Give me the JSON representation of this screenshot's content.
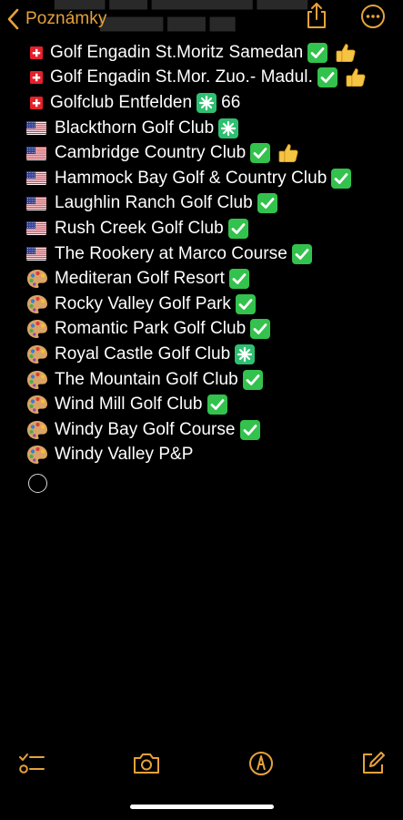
{
  "header": {
    "back_label": "Poznámky",
    "back_icon": "chevron-left-icon",
    "share_icon": "share-icon",
    "more_icon": "ellipsis-circle-icon",
    "accent": "#e6a23c"
  },
  "items": [
    {
      "flag": "swiss-flag-icon",
      "text": "Golf Engadin St.Moritz Samedan",
      "badges": [
        "check-mark-button-icon",
        "thumbs-up-icon"
      ],
      "suffix": ""
    },
    {
      "flag": "swiss-flag-icon",
      "text": "Golf Engadin St.Mor. Zuo.- Madul.",
      "badges": [
        "check-mark-button-icon",
        "thumbs-up-icon"
      ],
      "suffix": ""
    },
    {
      "flag": "swiss-flag-icon",
      "text": "Golfclub Entfelden",
      "badges": [
        "eight-spoked-asterisk-icon"
      ],
      "suffix": "66"
    },
    {
      "flag": "us-flag-icon",
      "text": "Blackthorn Golf Club",
      "badges": [
        "eight-spoked-asterisk-icon"
      ],
      "suffix": ""
    },
    {
      "flag": "us-flag-icon",
      "text": "Cambridge Country Club",
      "badges": [
        "check-mark-button-icon",
        "thumbs-up-icon"
      ],
      "suffix": ""
    },
    {
      "flag": "us-flag-icon",
      "text": "Hammock Bay Golf & Country Club",
      "badges": [
        "check-mark-button-icon"
      ],
      "suffix": ""
    },
    {
      "flag": "us-flag-icon",
      "text": "Laughlin Ranch Golf Club",
      "badges": [
        "check-mark-button-icon"
      ],
      "suffix": ""
    },
    {
      "flag": "us-flag-icon",
      "text": "Rush Creek Golf Club",
      "badges": [
        "check-mark-button-icon"
      ],
      "suffix": ""
    },
    {
      "flag": "us-flag-icon",
      "text": "The Rookery at Marco Course",
      "badges": [
        "check-mark-button-icon"
      ],
      "suffix": ""
    },
    {
      "flag": "artist-palette-icon",
      "text": "Mediteran Golf Resort",
      "badges": [
        "check-mark-button-icon"
      ],
      "suffix": ""
    },
    {
      "flag": "artist-palette-icon",
      "text": "Rocky Valley Golf Park",
      "badges": [
        "check-mark-button-icon"
      ],
      "suffix": ""
    },
    {
      "flag": "artist-palette-icon",
      "text": "Romantic Park Golf Club",
      "badges": [
        "check-mark-button-icon"
      ],
      "suffix": ""
    },
    {
      "flag": "artist-palette-icon",
      "text": "Royal Castle Golf Club",
      "badges": [
        "eight-spoked-asterisk-icon"
      ],
      "suffix": ""
    },
    {
      "flag": "artist-palette-icon",
      "text": "The Mountain Golf Club",
      "badges": [
        "check-mark-button-icon"
      ],
      "suffix": ""
    },
    {
      "flag": "artist-palette-icon",
      "text": "Wind Mill Golf Club",
      "badges": [
        "check-mark-button-icon"
      ],
      "suffix": ""
    },
    {
      "flag": "artist-palette-icon",
      "text": "Windy Bay Golf Course",
      "badges": [
        "check-mark-button-icon"
      ],
      "suffix": ""
    },
    {
      "flag": "artist-palette-icon",
      "text": "Windy Valley P&P",
      "badges": [],
      "suffix": ""
    }
  ],
  "empty_checklist_item": {
    "icon": "empty-checkbox-circle-icon"
  },
  "toolbar": {
    "items": [
      {
        "icon": "checklist-icon"
      },
      {
        "icon": "camera-icon"
      },
      {
        "icon": "markup-pen-icon"
      },
      {
        "icon": "compose-icon"
      }
    ]
  },
  "colors": {
    "background": "#000000",
    "text": "#ffffff",
    "accent": "#e6a23c",
    "check_green": "#33c24d",
    "asterisk_green": "#2fbf71"
  }
}
